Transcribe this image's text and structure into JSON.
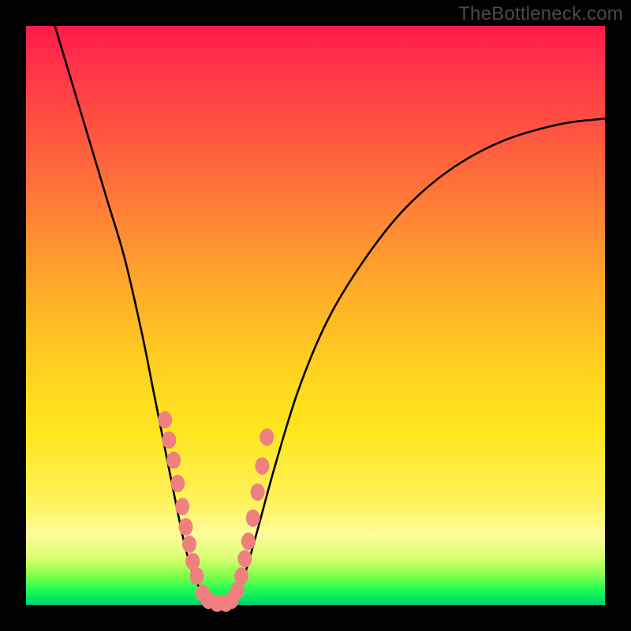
{
  "watermark": "TheBottleneck.com",
  "chart_data": {
    "type": "line",
    "title": "",
    "xlabel": "",
    "ylabel": "",
    "xlim": [
      0,
      100
    ],
    "ylim": [
      0,
      100
    ],
    "grid": false,
    "legend": false,
    "annotations": [],
    "series": [
      {
        "name": "left-curve",
        "stroke": "#000000",
        "x": [
          5,
          8,
          11,
          14,
          17,
          20,
          22,
          24,
          26,
          27.5,
          29,
          30.5,
          32
        ],
        "y": [
          100,
          90,
          80,
          70,
          60,
          47,
          37,
          27,
          17,
          10,
          5,
          2,
          0
        ]
      },
      {
        "name": "right-curve",
        "stroke": "#000000",
        "x": [
          35,
          36.5,
          38,
          40,
          43,
          47,
          52,
          58,
          65,
          73,
          82,
          92,
          100
        ],
        "y": [
          0,
          2,
          6,
          13,
          24,
          37,
          49,
          59,
          68,
          75,
          80,
          83,
          84
        ]
      },
      {
        "name": "marker-cluster",
        "type": "scatter",
        "color": "#f08080",
        "x": [
          24.0,
          24.7,
          25.5,
          26.2,
          27.0,
          27.6,
          28.2,
          28.8,
          29.5,
          30.5,
          31.5,
          33.0,
          34.5,
          35.5,
          36.5,
          37.2,
          37.8,
          38.4,
          39.2,
          40.0,
          40.8,
          41.6
        ],
        "y": [
          32.0,
          28.5,
          25.0,
          21.0,
          17.0,
          13.5,
          10.5,
          7.5,
          5.0,
          2.0,
          0.8,
          0.3,
          0.3,
          0.8,
          2.5,
          5.0,
          8.0,
          11.0,
          15.0,
          19.5,
          24.0,
          29.0
        ]
      }
    ],
    "gradient_background": {
      "top": "#ff1a4b",
      "mid": "#ffd41f",
      "bottom": "#00c877"
    }
  }
}
